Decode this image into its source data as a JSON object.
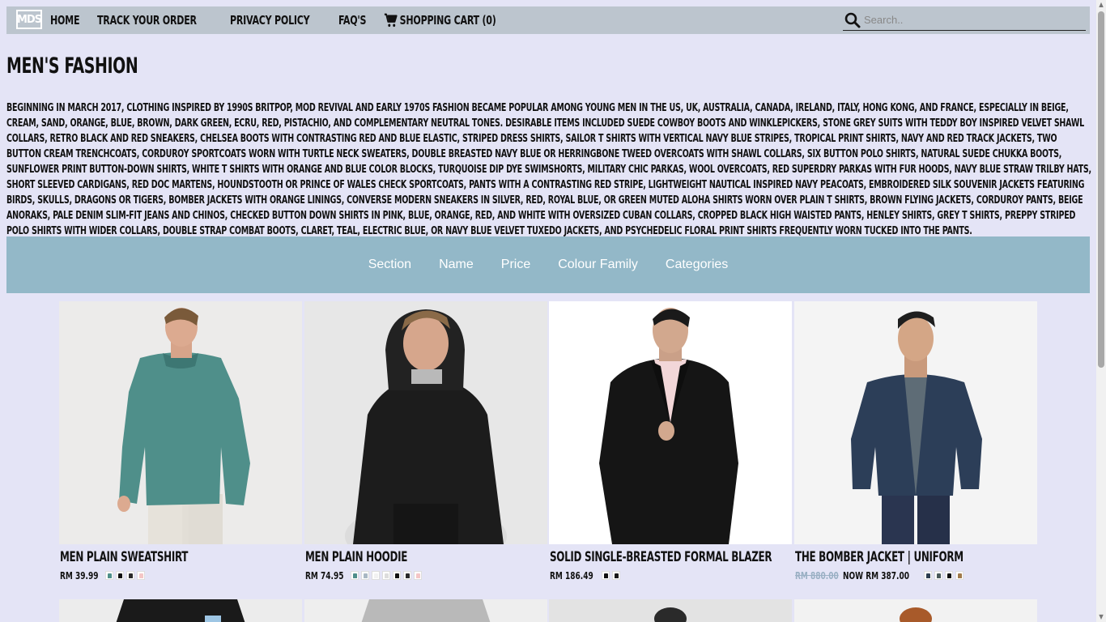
{
  "nav": {
    "logo_text": "MDS",
    "links": [
      "HOME",
      "TRACK YOUR ORDER",
      "PRIVACY POLICY",
      "FAQ'S"
    ],
    "cart_label": "SHOPPING CART (0)",
    "search_placeholder": "Search.."
  },
  "page": {
    "title": "MEN'S FASHION",
    "intro": "Beginning in March 2017, clothing inspired by 1990s Britpop, mod revival and early 1970s fashion became popular among young men in the US, UK, Australia, Canada, Ireland, Italy, Hong Kong, and France, especially in beige, cream, sand, orange, blue, brown, dark green, ecru, red, pistachio, and complementary neutral tones. Desirable items included suede cowboy boots and winklepickers, stone grey suits with Teddy Boy inspired velvet shawl collars, retro black and red sneakers, Chelsea boots with contrasting red and blue elastic, striped dress shirts, sailor T shirts with vertical navy blue stripes, tropical print shirts, navy and red track jackets, two button cream trenchcoats, corduroy sportcoats worn with turtle neck sweaters, double breasted navy blue or herringbone tweed overcoats with shawl collars, six button polo shirts, natural suede chukka boots, sunflower print button-down shirts, white T shirts with orange and blue color blocks, turquoise dip dye swimshorts, military chic parkas, wool overcoats, red Superdry parkas with fur hoods, navy blue straw trilby hats, short sleeved cardigans, red Doc Martens, houndstooth or Prince of Wales check sportcoats, pants with a contrasting red stripe, lightweight nautical inspired navy peacoats, embroidered silk souvenir jackets featuring birds, skulls, dragons or tigers, bomber jackets with orange linings, Converse modern sneakers in silver, red, royal blue, or green muted aloha shirts worn over plain T shirts, brown flying jackets, corduroy pants, beige anoraks, pale denim slim-fit jeans and chinos, checked button down shirts in pink, blue, orange, red, and white with oversized Cuban collars, cropped black high waisted pants, Henley shirts, grey T shirts, preppy striped polo shirts with wider collars, double strap combat boots, claret, teal, electric blue, or navy blue velvet tuxedo jackets, and psychedelic floral print shirts frequently worn tucked into the pants."
  },
  "filters": [
    "Section",
    "Name",
    "Price",
    "Colour Family",
    "Categories"
  ],
  "products": [
    {
      "name": "Men Plain Sweatshirt",
      "price": "RM 39.99",
      "old_price": "",
      "swatches": [
        "#4f8f8a",
        "#111111",
        "#2a2a2a",
        "#f4c6c6"
      ]
    },
    {
      "name": "Men Plain Hoodie",
      "price": "RM 74.95",
      "old_price": "",
      "swatches": [
        "#4f8f8a",
        "#a9b8c4",
        "#f2f2f2",
        "#dddddd",
        "#111111",
        "#2a2a2a",
        "#f4c6c6"
      ]
    },
    {
      "name": "Solid Single-Breasted Formal Blazer",
      "price": "RM 186.49",
      "old_price": "",
      "swatches": [
        "#111111",
        "#1a1a1a"
      ]
    },
    {
      "name": "The Bomber Jacket | UNIFORM",
      "price": "NOW RM 387.00",
      "old_price": "RM 880.00",
      "swatches": [
        "#2c3e50",
        "#4a5a5a",
        "#111111",
        "#a07a4a"
      ]
    }
  ]
}
